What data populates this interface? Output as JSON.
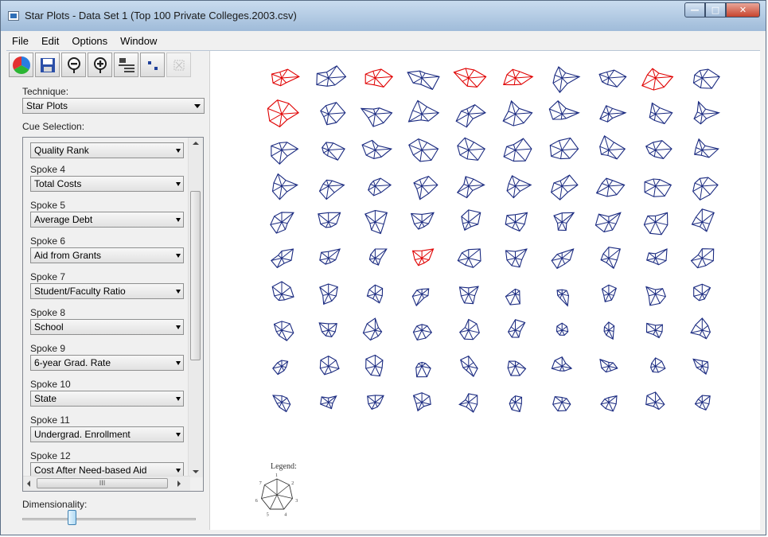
{
  "window": {
    "title": "Star Plots - Data Set 1 (Top 100 Private Colleges.2003.csv)",
    "buttons": {
      "minimize": "—",
      "maximize": "□",
      "close": "✕"
    }
  },
  "menu": [
    "File",
    "Edit",
    "Options",
    "Window"
  ],
  "toolbar": {
    "icons": [
      "color-wheel-icon",
      "save-icon",
      "zoom-out-icon",
      "zoom-in-icon",
      "layout-icon",
      "scatter-icon",
      "grid-icon"
    ]
  },
  "technique": {
    "label": "Technique:",
    "value": "Star Plots"
  },
  "cue_selection": {
    "label": "Cue Selection:",
    "first_value": "Quality Rank",
    "spokes": [
      {
        "label": "Spoke 4",
        "value": "Total Costs"
      },
      {
        "label": "Spoke 5",
        "value": "Average Debt"
      },
      {
        "label": "Spoke 6",
        "value": "Aid from Grants"
      },
      {
        "label": "Spoke 7",
        "value": "Student/Faculty Ratio"
      },
      {
        "label": "Spoke 8",
        "value": "School"
      },
      {
        "label": "Spoke 9",
        "value": "6-year Grad. Rate"
      },
      {
        "label": "Spoke 10",
        "value": "State"
      },
      {
        "label": "Spoke 11",
        "value": "Undergrad. Enrollment"
      },
      {
        "label": "Spoke 12",
        "value": "Cost After Need-based Aid"
      }
    ],
    "hscroll_grip": "III"
  },
  "dimensionality": {
    "label": "Dimensionality:",
    "level_fraction": 0.28
  },
  "plot": {
    "line_color": "#1a2a80",
    "highlight_color": "#e00000",
    "rows": 10,
    "cols": 10,
    "highlighted": [
      0,
      2,
      4,
      5,
      8,
      10,
      53
    ],
    "legend": {
      "title": "Legend:",
      "spoke_labels": [
        "1",
        "2",
        "3",
        "4",
        "5",
        "6",
        "7"
      ]
    }
  }
}
